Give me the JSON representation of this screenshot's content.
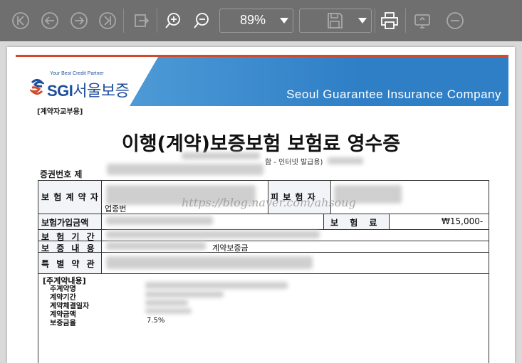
{
  "toolbar": {
    "zoom": "89%",
    "icons": [
      "first-page-icon",
      "prev-page-icon",
      "next-page-icon",
      "last-page-icon",
      "export-icon",
      "zoom-in-icon",
      "zoom-out-icon",
      "save-icon",
      "print-icon",
      "share-icon",
      "close-icon"
    ]
  },
  "document": {
    "logo_tagline": "Your Best Credit Partner",
    "logo_brand": "SGI",
    "logo_brand_ko": "서울보증",
    "banner_text": "Seoul Guarantee Insurance Company",
    "sub_tag": "[계약자교부용]",
    "title": "이행(계약)보증보험 보험료 영수증",
    "cert_no_label": "증권번호 제",
    "cert_note": "함 - 인터넷 발급용)",
    "watermark": "https://blog.naver.com/ahsoug",
    "rows": {
      "policyholder_label": "보 험 계 약 자",
      "insured_label": "피 보 험 자",
      "insured_amount_label": "보험가입금액",
      "premium_label": "보 험 료",
      "premium_value": "₩15,000-",
      "period_label": "보 험 기 간",
      "guarantee_label": "보 증 내 용",
      "guarantee_value": "계약보증금",
      "special_label": "특 별 약 관"
    },
    "main_contract": {
      "heading": "[주계약내용]",
      "items": [
        "주계약명",
        "계약기간",
        "계약체결일자",
        "계약금액",
        "보증금율"
      ],
      "rate_value": "7.5%"
    },
    "partial_text": "업종번"
  },
  "colors": {
    "toolbar_bg": "#6f6f6f",
    "banner_blue": "#2f7fc7",
    "banner_stripe": "#d34a2a",
    "brand_blue": "#1e4f9b"
  }
}
